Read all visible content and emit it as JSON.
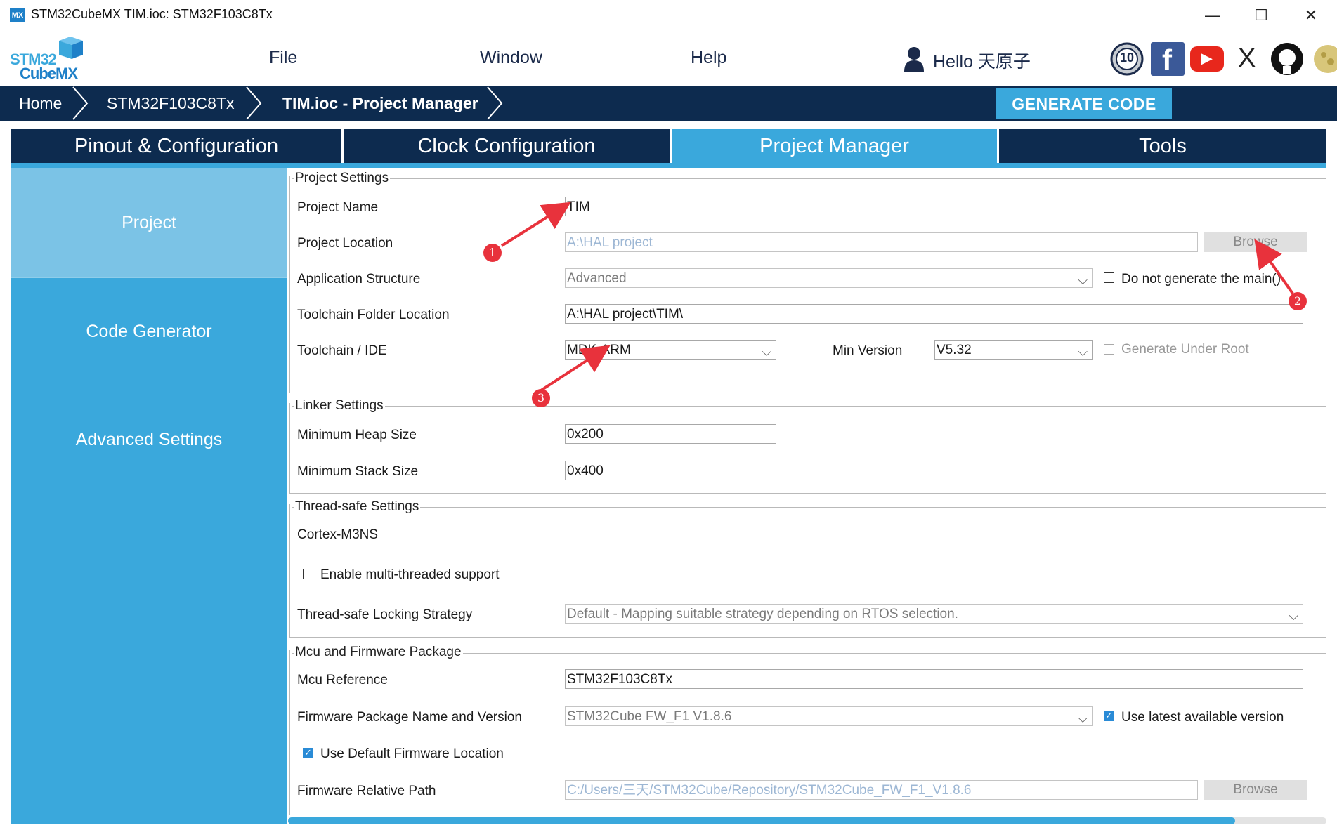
{
  "window": {
    "icon_text": "MX",
    "title": "STM32CubeMX TIM.ioc: STM32F103C8Tx",
    "minimize": "—",
    "maximize": "☐",
    "close": "✕"
  },
  "logo": {
    "line1": "STM32",
    "line2": "CubeMX"
  },
  "menu": {
    "file": "File",
    "window": "Window",
    "help": "Help"
  },
  "user": {
    "greeting": "Hello 天原子"
  },
  "social": {
    "anniversary": "10",
    "facebook": "f",
    "youtube": "▶",
    "x": "X"
  },
  "breadcrumb": {
    "home": "Home",
    "device": "STM32F103C8Tx",
    "current": "TIM.ioc - Project Manager"
  },
  "generate_code": "GENERATE CODE",
  "tabs": {
    "pinout": "Pinout & Configuration",
    "clock": "Clock Configuration",
    "project_manager": "Project Manager",
    "tools": "Tools"
  },
  "leftnav": {
    "project": "Project",
    "code_generator": "Code Generator",
    "advanced_settings": "Advanced Settings"
  },
  "project_settings": {
    "title": "Project Settings",
    "name_label": "Project Name",
    "name_value": "TIM",
    "location_label": "Project Location",
    "location_value": "A:\\HAL project",
    "browse": "Browse",
    "app_structure_label": "Application Structure",
    "app_structure_value": "Advanced",
    "no_main_label": "Do not generate the main()",
    "toolchain_folder_label": "Toolchain Folder Location",
    "toolchain_folder_value": "A:\\HAL project\\TIM\\",
    "toolchain_label": "Toolchain / IDE",
    "toolchain_value": "MDK-ARM",
    "min_version_label": "Min Version",
    "min_version_value": "V5.32",
    "gen_under_root_label": "Generate Under Root"
  },
  "linker_settings": {
    "title": "Linker Settings",
    "heap_label": "Minimum Heap Size",
    "heap_value": "0x200",
    "stack_label": "Minimum Stack Size",
    "stack_value": "0x400"
  },
  "thread_safe": {
    "title": "Thread-safe Settings",
    "core": "Cortex-M3NS",
    "multithread_label": "Enable multi-threaded support",
    "locking_label": "Thread-safe Locking Strategy",
    "locking_value": "Default  -  Mapping suitable strategy depending on RTOS selection."
  },
  "mcu_firmware": {
    "title": "Mcu and Firmware Package",
    "mcu_ref_label": "Mcu Reference",
    "mcu_ref_value": "STM32F103C8Tx",
    "fw_name_label": "Firmware Package Name and Version",
    "fw_name_value": "STM32Cube FW_F1 V1.8.6",
    "use_latest_label": "Use latest available version",
    "use_default_label": "Use Default Firmware Location",
    "fw_path_label": "Firmware Relative Path",
    "fw_path_value": "C:/Users/三天/STM32Cube/Repository/STM32Cube_FW_F1_V1.8.6",
    "browse": "Browse"
  },
  "annotations": {
    "m1": "1",
    "m2": "2",
    "m3": "3"
  },
  "colors": {
    "navy": "#0d2b4f",
    "accent": "#3aa8dc",
    "active_nav": "#7bc3e6",
    "marker": "#e8323c"
  }
}
